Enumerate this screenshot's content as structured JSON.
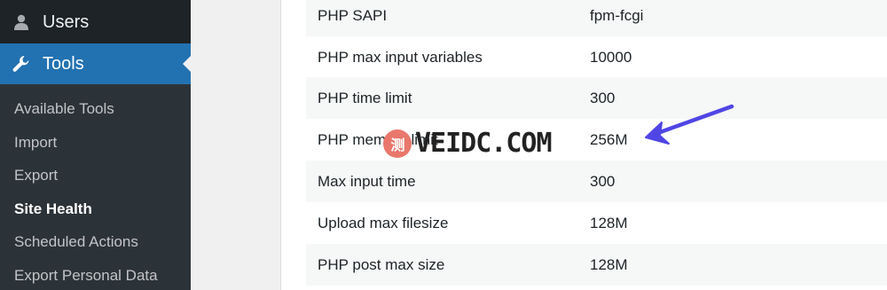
{
  "sidebar": {
    "users_label": "Users",
    "tools_label": "Tools",
    "submenu": [
      {
        "label": "Available Tools"
      },
      {
        "label": "Import"
      },
      {
        "label": "Export"
      },
      {
        "label": "Site Health",
        "current": true
      },
      {
        "label": "Scheduled Actions"
      },
      {
        "label": "Export Personal Data"
      }
    ]
  },
  "info_table": [
    {
      "label": "PHP SAPI",
      "value": "fpm-fcgi"
    },
    {
      "label": "PHP max input variables",
      "value": "10000"
    },
    {
      "label": "PHP time limit",
      "value": "300"
    },
    {
      "label": "PHP memory limit",
      "value": "256M"
    },
    {
      "label": "Max input time",
      "value": "300"
    },
    {
      "label": "Upload max filesize",
      "value": "128M"
    },
    {
      "label": "PHP post max size",
      "value": "128M"
    }
  ],
  "watermark": {
    "seal_text": "测",
    "text": "VEIDC.COM"
  },
  "colors": {
    "sidebar_bg": "#1d2327",
    "active_bg": "#2271b1",
    "arrow": "#5046e5"
  },
  "icons": {
    "users": "users-icon",
    "tools": "wrench-icon",
    "annotation": "arrow-icon"
  }
}
